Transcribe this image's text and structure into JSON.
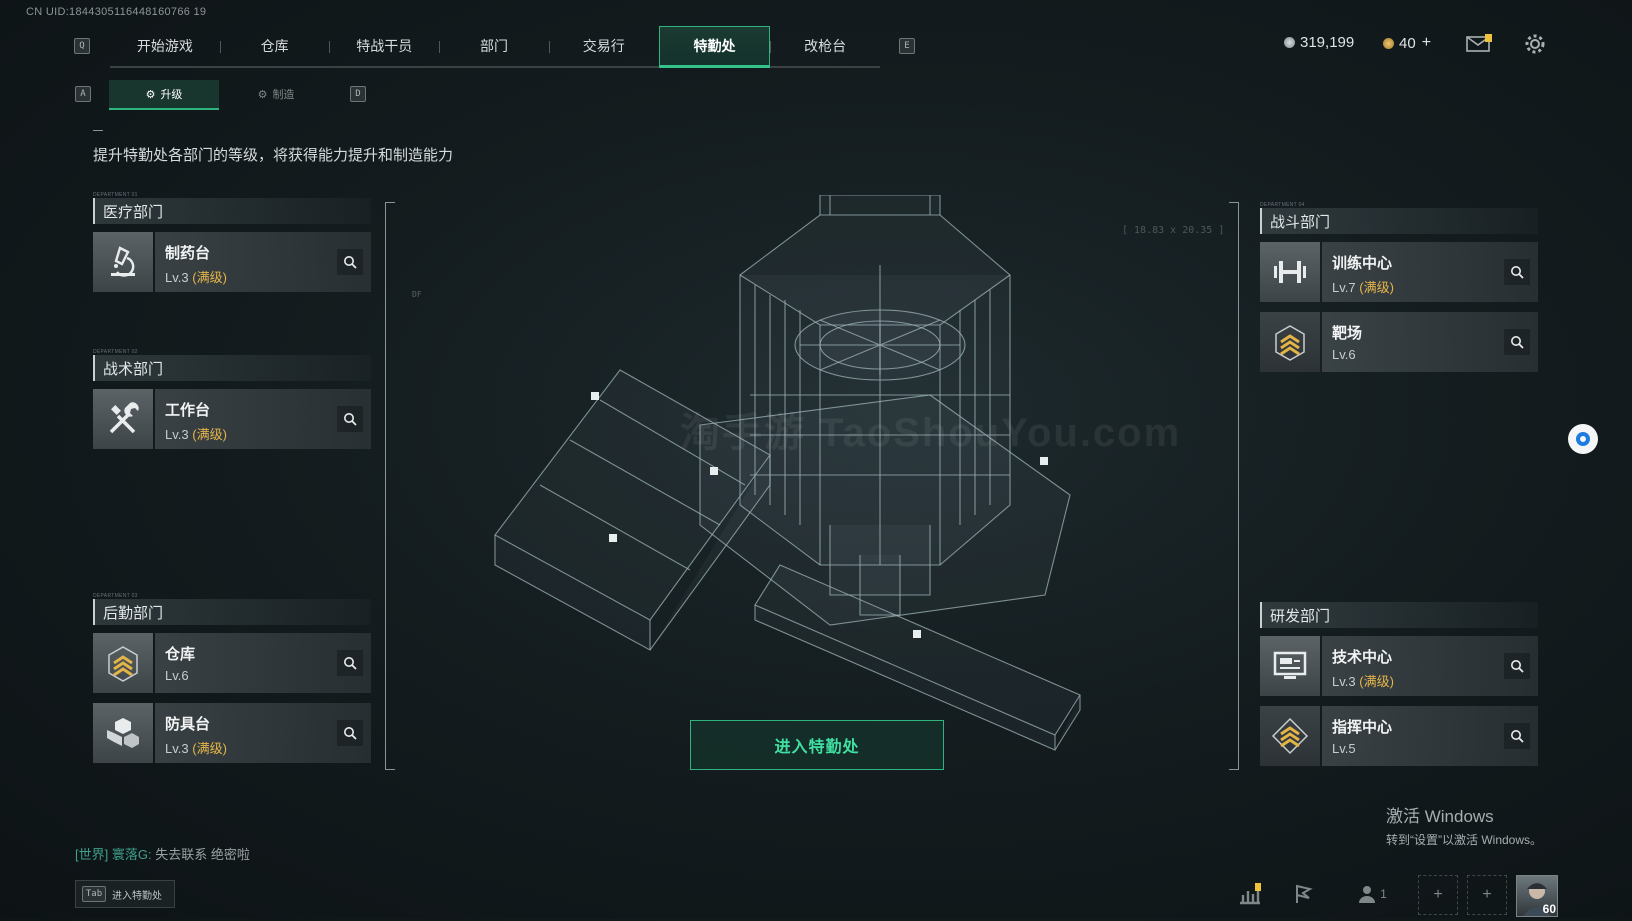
{
  "uid": "CN UID:1844305116448160766 19",
  "topnav": {
    "left_key": "Q",
    "right_key": "E",
    "tabs": [
      "开始游戏",
      "仓库",
      "特战干员",
      "部门",
      "交易行",
      "特勤处",
      "改枪台"
    ],
    "active_index": 5
  },
  "currency": {
    "coins": "319,199",
    "tickets": "40"
  },
  "subtabs": {
    "left_key": "A",
    "right_key": "D",
    "upgrade": "升级",
    "craft": "制造"
  },
  "description": "提升特勤处各部门的等级，将获得能力提升和制造能力",
  "departments": {
    "medical": {
      "tag": "DEPARTMENT 01",
      "title": "医疗部门",
      "items": [
        {
          "name": "制药台",
          "level": "Lv.3",
          "maxed": "(满级)",
          "icon": "microscope-icon"
        }
      ]
    },
    "tactical": {
      "tag": "DEPARTMENT 02",
      "title": "战术部门",
      "items": [
        {
          "name": "工作台",
          "level": "Lv.3",
          "maxed": "(满级)",
          "icon": "tools-icon"
        }
      ]
    },
    "logistics": {
      "tag": "DEPARTMENT 03",
      "title": "后勤部门",
      "items": [
        {
          "name": "仓库",
          "level": "Lv.6",
          "maxed": "",
          "icon": "rank-chevron-icon"
        },
        {
          "name": "防具台",
          "level": "Lv.3",
          "maxed": "(满级)",
          "icon": "cubes-icon"
        }
      ]
    },
    "combat": {
      "tag": "DEPARTMENT 04",
      "title": "战斗部门",
      "items": [
        {
          "name": "训练中心",
          "level": "Lv.7",
          "maxed": "(满级)",
          "icon": "dumbbell-icon"
        },
        {
          "name": "靶场",
          "level": "Lv.6",
          "maxed": "",
          "icon": "rank-chevron-icon"
        }
      ]
    },
    "research": {
      "tag": "",
      "title": "研发部门",
      "items": [
        {
          "name": "技术中心",
          "level": "Lv.3",
          "maxed": "(满级)",
          "icon": "monitor-icon"
        },
        {
          "name": "指挥中心",
          "level": "Lv.5",
          "maxed": "",
          "icon": "rank-chevron-icon"
        }
      ]
    }
  },
  "center": {
    "enter_button": "进入特勤处",
    "coords": "[ 18.83 x 20.35 ]",
    "df": "DF",
    "watermark": "淘手游 TaoShouYou.com"
  },
  "chat": {
    "channel": "[世界]",
    "user": "寰落G:",
    "message": "失去联系 绝密啦"
  },
  "tab_hint": {
    "key": "Tab",
    "label": "进入特勤处"
  },
  "windows_activation": {
    "line1": "激活 Windows",
    "line2": "转到“设置”以激活 Windows。"
  },
  "bottom_bar": {
    "friends_count": "1",
    "avatar_level": "60"
  },
  "colors": {
    "accent": "#2fb37f",
    "maxed": "#e6b54a",
    "alert": "#f0c23c"
  }
}
